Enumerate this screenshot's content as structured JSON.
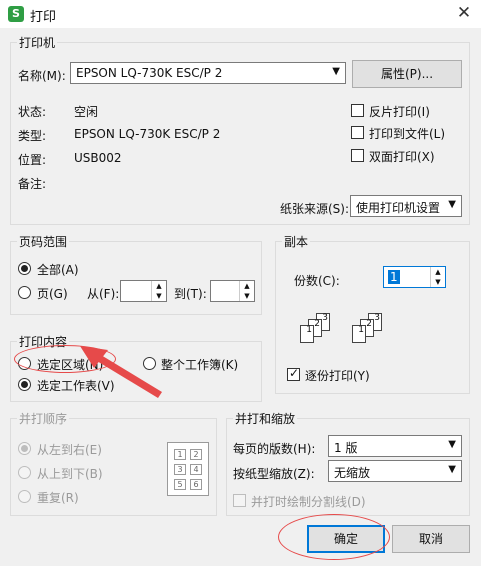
{
  "window": {
    "title": "打印",
    "app_icon_glyph": "S"
  },
  "printer": {
    "section_title": "打印机",
    "name_label": "名称(M):",
    "name_value": "EPSON LQ-730K ESC/P 2",
    "properties_button": "属性(P)...",
    "status_label": "状态:",
    "status_value": "空闲",
    "type_label": "类型:",
    "type_value": "EPSON LQ-730K ESC/P 2",
    "where_label": "位置:",
    "where_value": "USB002",
    "comment_label": "备注:",
    "reverse_print": {
      "label": "反片打印(I)",
      "checked": false
    },
    "print_to_file": {
      "label": "打印到文件(L)",
      "checked": false
    },
    "duplex": {
      "label": "双面打印(X)",
      "checked": false
    },
    "paper_source_label": "纸张来源(S):",
    "paper_source_value": "使用打印机设置"
  },
  "page_range": {
    "section_title": "页码范围",
    "all_label": "全部(A)",
    "pages_label": "页(G)",
    "from_label": "从(F):",
    "to_label": "到(T):",
    "selected": "all"
  },
  "copies": {
    "section_title": "副本",
    "count_label": "份数(C):",
    "count_value": "1",
    "collate": {
      "label": "逐份打印(Y)",
      "checked": true
    },
    "collate_page_numbers_a": [
      "1",
      "2",
      "3"
    ],
    "collate_page_numbers_b": [
      "1",
      "2",
      "3"
    ]
  },
  "print_what": {
    "section_title": "打印内容",
    "selection_label": "选定区域(N)",
    "entire_workbook_label": "整个工作簿(K)",
    "active_sheets_label": "选定工作表(V)",
    "selected": "active_sheets"
  },
  "order": {
    "section_title": "并打顺序",
    "left_to_right": "从左到右(E)",
    "top_to_bottom": "从上到下(B)",
    "repeat": "重复(R)",
    "grid_numbers": [
      "1",
      "2",
      "3",
      "4",
      "5",
      "6"
    ]
  },
  "zoom": {
    "section_title": "并打和缩放",
    "pages_per_sheet_label": "每页的版数(H):",
    "pages_per_sheet_value": "1 版",
    "scale_label": "按纸型缩放(Z):",
    "scale_value": "无缩放",
    "draw_borders": {
      "label": "并打时绘制分割线(D)",
      "checked": false
    }
  },
  "buttons": {
    "ok": "确定",
    "cancel": "取消"
  },
  "colors": {
    "annotation_red": "#e64a4a",
    "focus_blue": "#0078d7",
    "app_green": "#2f9e44"
  }
}
